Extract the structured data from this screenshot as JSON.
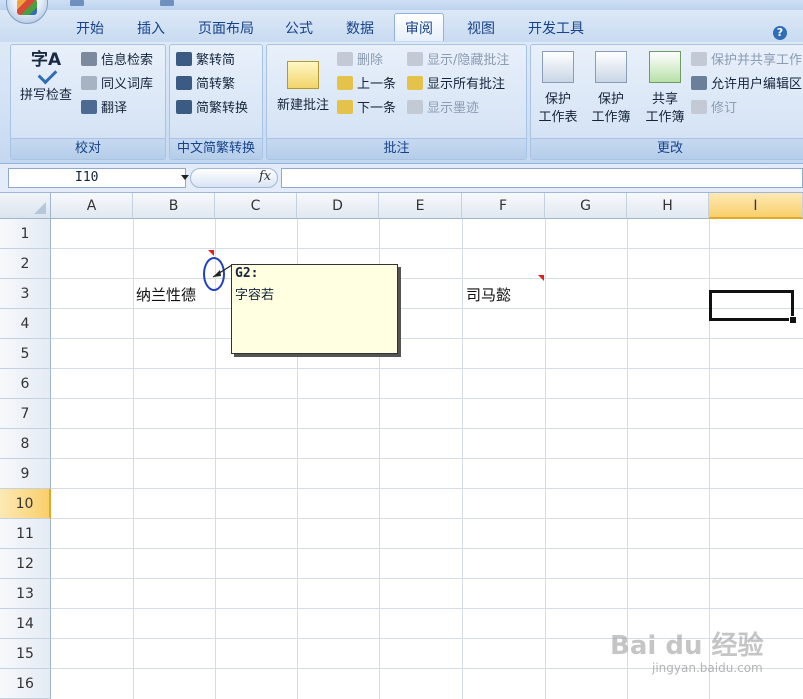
{
  "ribbon": {
    "tabs": [
      {
        "label": "开始"
      },
      {
        "label": "插入"
      },
      {
        "label": "页面布局"
      },
      {
        "label": "公式"
      },
      {
        "label": "数据"
      },
      {
        "label": "审阅"
      },
      {
        "label": "视图"
      },
      {
        "label": "开发工具"
      }
    ],
    "active_tab": "审阅",
    "help_label": "?",
    "groups": {
      "proofing": {
        "label": "校对",
        "spell_check": "拼写检查",
        "spell_icon_text": "字A",
        "research": "信息检索",
        "thesaurus": "同义词库",
        "translate": "翻译"
      },
      "chinese_conversion": {
        "label": "中文简繁转换",
        "to_simplified": "繁转简",
        "to_traditional": "简转繁",
        "convert": "简繁转换"
      },
      "comments": {
        "label": "批注",
        "new_comment": "新建批注",
        "delete": "删除",
        "previous": "上一条",
        "next": "下一条",
        "show_hide": "显示/隐藏批注",
        "show_all": "显示所有批注",
        "show_ink": "显示墨迹"
      },
      "changes": {
        "label": "更改",
        "protect_sheet_1": "保护",
        "protect_sheet_2": "工作表",
        "protect_workbook_1": "保护",
        "protect_workbook_2": "工作簿",
        "share_workbook_1": "共享",
        "share_workbook_2": "工作簿",
        "protect_share": "保护并共享工作",
        "allow_edit": "允许用户编辑区",
        "track_changes": "修订"
      }
    }
  },
  "formula_bar": {
    "name_box": "I10",
    "fx_label": "fx",
    "formula": ""
  },
  "sheet": {
    "columns": [
      "A",
      "B",
      "C",
      "D",
      "E",
      "F",
      "G",
      "H",
      "I"
    ],
    "rows": [
      "1",
      "2",
      "3",
      "4",
      "5",
      "6",
      "7",
      "8",
      "9",
      "10",
      "11",
      "12",
      "13",
      "14",
      "15",
      "16"
    ],
    "selected_cell": "I10",
    "cells": {
      "B3": "纳兰性德",
      "F3": "司马懿"
    }
  },
  "comment": {
    "author": "G2:",
    "text": "字容若"
  },
  "watermark": {
    "main": "Bai du 经验",
    "sub": "jingyan.baidu.com"
  },
  "colors": {
    "ribbon_text": "#15428b",
    "selection_header": "#f9cf6a",
    "comment_bg": "#ffffe1",
    "comment_indicator": "#e02020",
    "annotation_circle": "#1f3fc4"
  }
}
